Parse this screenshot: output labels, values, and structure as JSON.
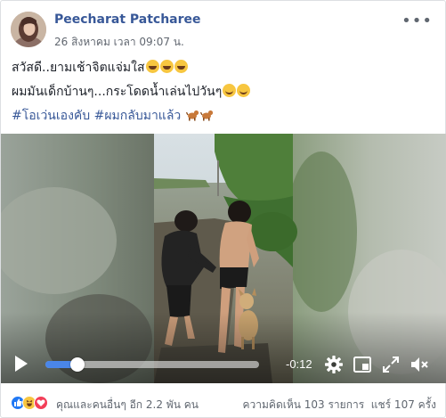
{
  "post": {
    "author": "Peecharat Patcharee",
    "timestamp": "26 สิงหาคม เวลา 09:07 น.",
    "more_icon": "ellipsis-icon",
    "lines": [
      "สวัสดี..ยามเช้าจิตแจ่มใส",
      "ผมมันเด็กบ้านๆ...กระโดดน้ำเล่นไปวันๆ"
    ],
    "hashtags": [
      "#โอเว่นเองคับ",
      "#ผมกลับมาแล้ว"
    ],
    "emojis": {
      "line1": [
        "laughing-emoji",
        "laughing-emoji",
        "laughing-emoji"
      ],
      "line2": [
        "smiling-emoji",
        "smiling-emoji"
      ],
      "line3": [
        "dog-emoji",
        "dog-emoji"
      ]
    }
  },
  "video": {
    "time_remaining": "-0:12",
    "progress": 0.15,
    "icons": [
      "play-icon",
      "settings-gear-icon",
      "picture-in-picture-icon",
      "fullscreen-icon",
      "volume-icon"
    ]
  },
  "footer": {
    "reactions": [
      "like-icon",
      "haha-icon",
      "love-icon"
    ],
    "friends_text": "คุณและคนอื่นๆ อีก 2.2 พัน คน",
    "comments_text": "ความคิดเห็น 103 รายการ",
    "shares_text": "แชร์ 107 ครั้ง"
  },
  "colors": {
    "link": "#385898",
    "progress": "#4a86e8",
    "like": "#2078f4",
    "love": "#f33e58",
    "haha": "#f7c640"
  }
}
